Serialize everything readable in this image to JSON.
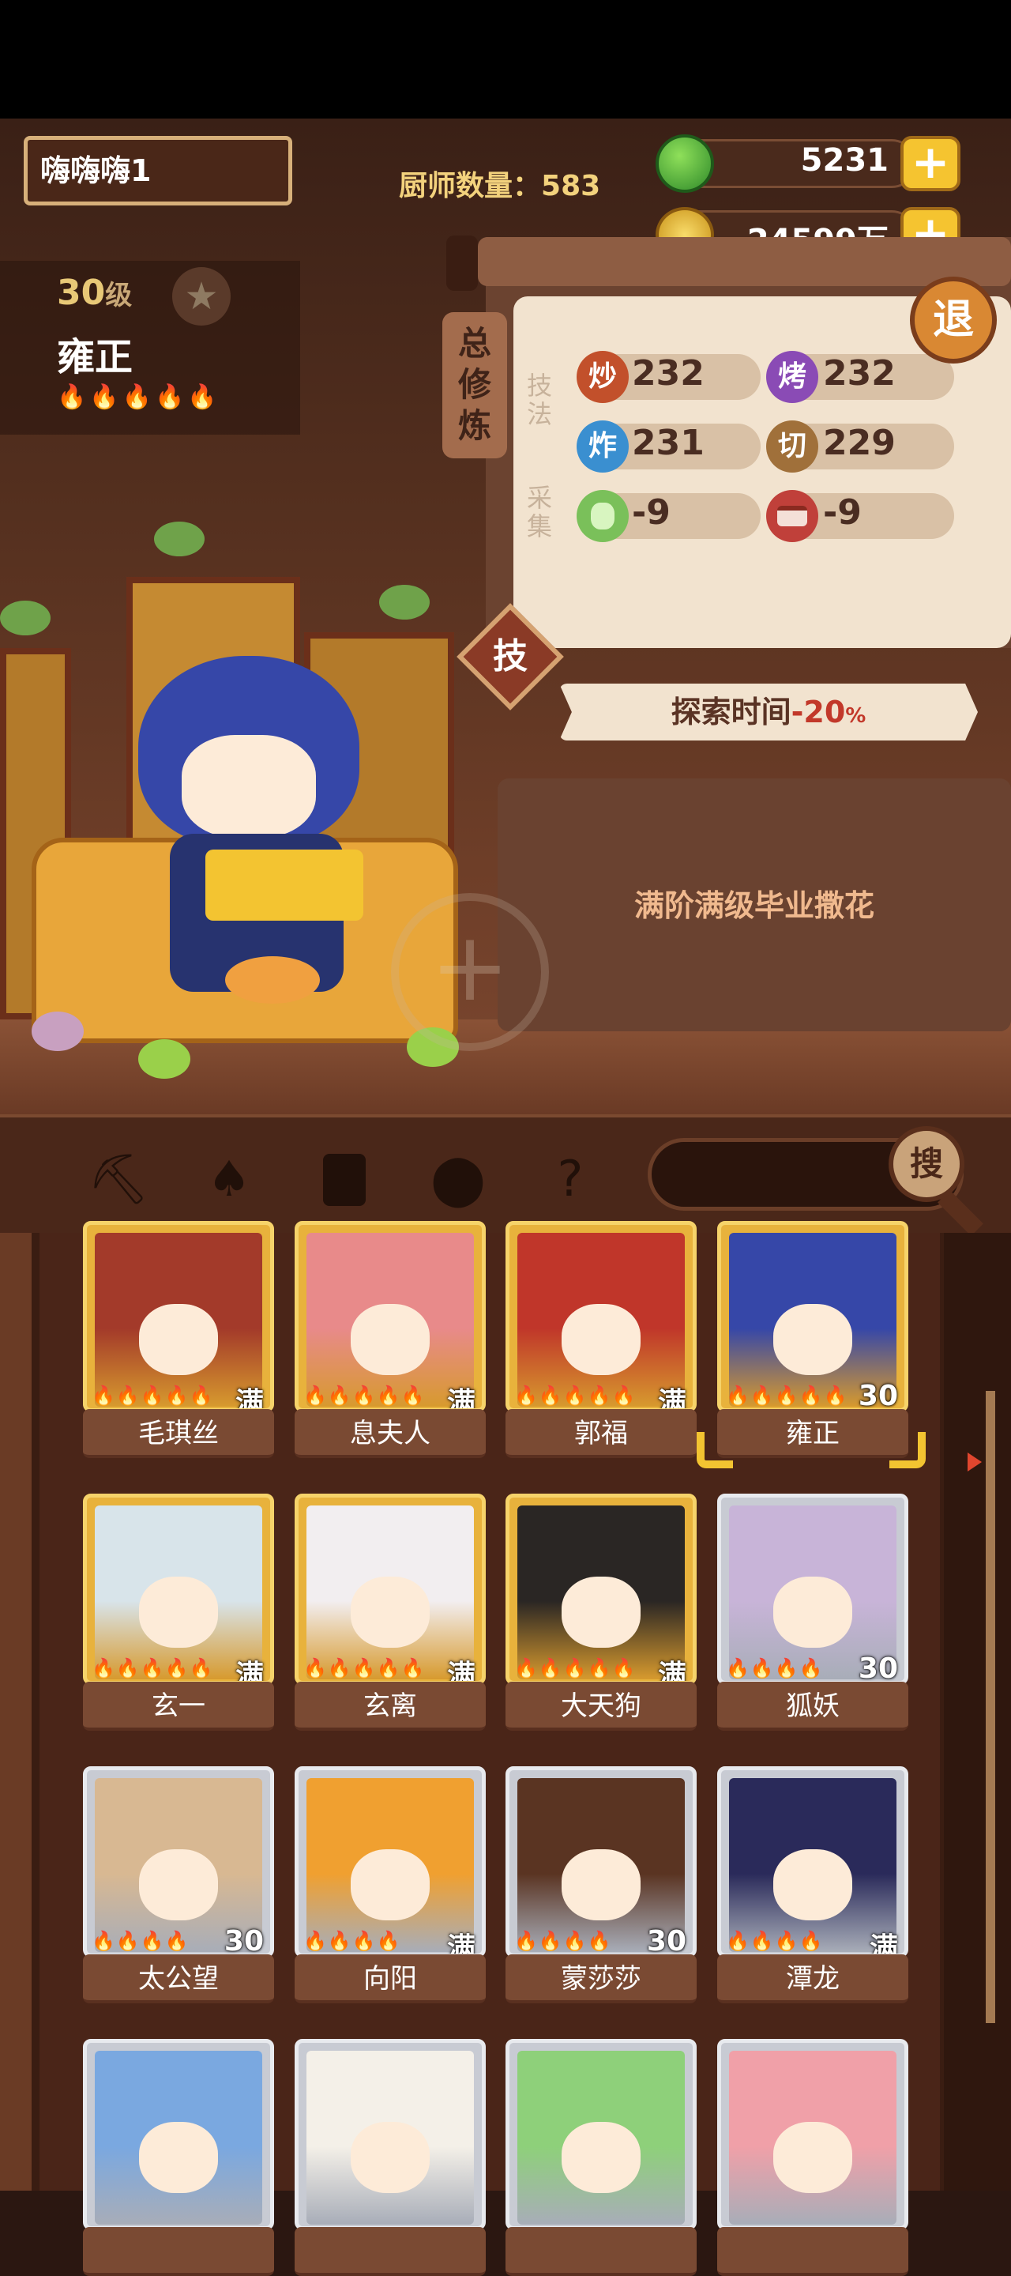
{
  "header": {
    "player_name": "嗨嗨嗨1",
    "chef_count_label": "厨师数量：",
    "chef_count": "583",
    "jade_amount": "5231",
    "coin_amount": "24599万",
    "plus_symbol": "+"
  },
  "character": {
    "level": "30",
    "level_unit": "级",
    "name": "雍正",
    "flames": "🔥🔥🔥🔥🔥",
    "star_icon": "star-icon"
  },
  "training_panel": {
    "tab_label": "总修炼",
    "section_technique": "技法",
    "section_gather": "采集",
    "exit_label": "退",
    "stats": [
      {
        "icon_char": "炒",
        "value": "232",
        "color": "#c2502b"
      },
      {
        "icon_char": "烤",
        "value": "232",
        "color": "#8a4bb5"
      },
      {
        "icon_char": "炸",
        "value": "231",
        "color": "#3a8fd0"
      },
      {
        "icon_char": "切",
        "value": "229",
        "color": "#a0703a"
      },
      {
        "icon_char": "",
        "value": "-9",
        "color": "#7ac05a"
      },
      {
        "icon_char": "",
        "value": "-9",
        "color": "#c0403a"
      }
    ],
    "skill_label": "技",
    "explore_prefix": "探索时间",
    "explore_value": "-20",
    "explore_unit": "%",
    "description": "满阶满级毕业撒花"
  },
  "toolbar": {
    "tools": [
      "shovel-icon",
      "spade-icon",
      "jar-icon",
      "location-pin-icon",
      "map-question-icon"
    ],
    "search_label": "搜"
  },
  "chef_list": [
    {
      "name": "毛琪丝",
      "badge": "满",
      "flames": "🔥🔥🔥🔥🔥",
      "frame": "gold",
      "hair": "#a33a2a"
    },
    {
      "name": "息夫人",
      "badge": "满",
      "flames": "🔥🔥🔥🔥🔥",
      "frame": "gold",
      "hair": "#e88a8a"
    },
    {
      "name": "郭福",
      "badge": "满",
      "flames": "🔥🔥🔥🔥🔥",
      "frame": "gold",
      "hair": "#c0362a"
    },
    {
      "name": "雍正",
      "badge": "30",
      "flames": "🔥🔥🔥🔥🔥",
      "frame": "gold",
      "hair": "#3647a8"
    },
    {
      "name": "玄一",
      "badge": "满",
      "flames": "🔥🔥🔥🔥🔥",
      "frame": "gold",
      "hair": "#d8e4ea"
    },
    {
      "name": "玄离",
      "badge": "满",
      "flames": "🔥🔥🔥🔥🔥",
      "frame": "gold",
      "hair": "#f2eef0"
    },
    {
      "name": "大天狗",
      "badge": "满",
      "flames": "🔥🔥🔥🔥🔥",
      "frame": "gold",
      "hair": "#2a2624"
    },
    {
      "name": "狐妖",
      "badge": "30",
      "flames": "🔥🔥🔥🔥",
      "frame": "silver",
      "hair": "#c8b4d8"
    },
    {
      "name": "太公望",
      "badge": "30",
      "flames": "🔥🔥🔥🔥",
      "frame": "silver",
      "hair": "#d8b892"
    },
    {
      "name": "向阳",
      "badge": "满",
      "flames": "🔥🔥🔥🔥",
      "frame": "silver",
      "hair": "#f0a030"
    },
    {
      "name": "蒙莎莎",
      "badge": "30",
      "flames": "🔥🔥🔥🔥",
      "frame": "silver",
      "hair": "#5a3422"
    },
    {
      "name": "潭龙",
      "badge": "满",
      "flames": "🔥🔥🔥🔥",
      "frame": "silver",
      "hair": "#2a2a5a"
    },
    {
      "name": "",
      "badge": "",
      "flames": "",
      "frame": "silver",
      "hair": "#7aa8e0"
    },
    {
      "name": "",
      "badge": "",
      "flames": "",
      "frame": "silver",
      "hair": "#f4f0e8"
    },
    {
      "name": "",
      "badge": "",
      "flames": "",
      "frame": "silver",
      "hair": "#8ed07a"
    },
    {
      "name": "",
      "badge": "",
      "flames": "",
      "frame": "silver",
      "hair": "#f0a0a8"
    }
  ],
  "colors": {
    "accent_gold": "#f3c431",
    "panel_cream": "#f2e3cf",
    "wood_dark": "#4a2518"
  }
}
